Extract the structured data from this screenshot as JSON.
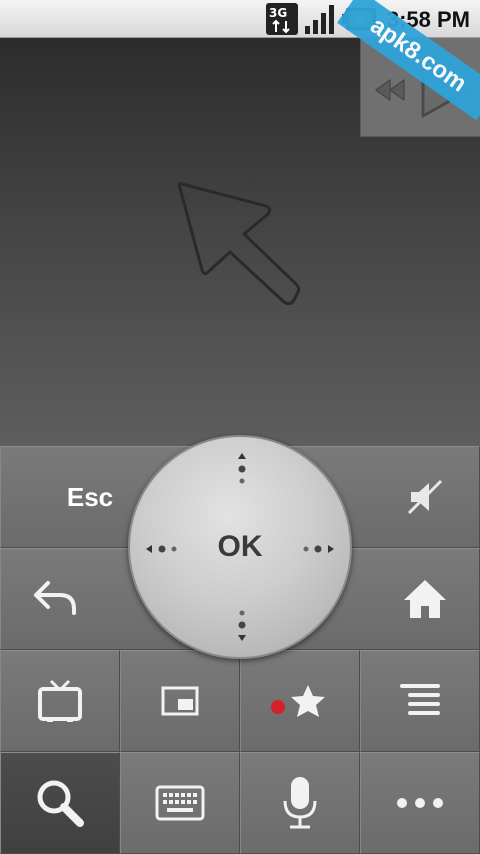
{
  "status_bar": {
    "network": "3G",
    "time": "3:58 PM",
    "icons": [
      "3g-data-icon",
      "signal-icon",
      "battery-charging-icon"
    ]
  },
  "watermark": {
    "text": "apk8.com"
  },
  "media": {
    "icons": [
      "rewind-icon",
      "play-icon"
    ]
  },
  "touchpad": {
    "icon": "cursor-arrow-icon"
  },
  "controls": {
    "esc_label": "Esc",
    "ok_label": "OK",
    "icons": [
      "mute-icon",
      "back-icon",
      "home-icon",
      "tv-icon",
      "picture-in-picture-icon",
      "record-favorite-icon",
      "search-icon",
      "keyboard-icon",
      "microphone-icon",
      "more-icon"
    ]
  },
  "colors": {
    "record_dot": "#d3202a",
    "icon": "#ffffff",
    "panel": "#707070"
  }
}
